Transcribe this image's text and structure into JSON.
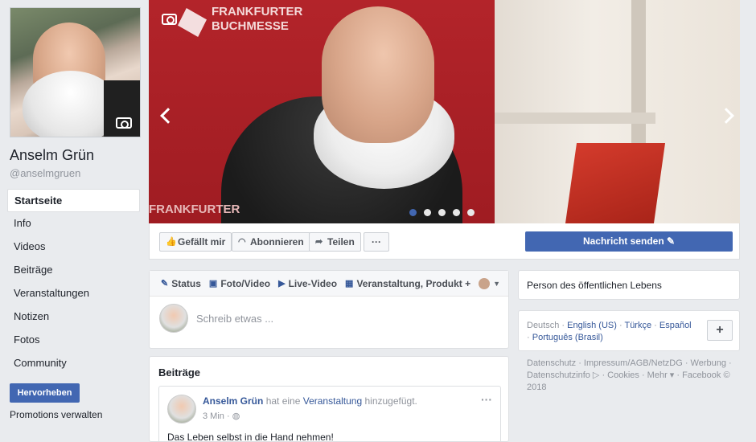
{
  "left": {
    "page_name": "Anselm Grün",
    "handle": "@anselmgruen",
    "nav": [
      "Startseite",
      "Info",
      "Videos",
      "Beiträge",
      "Veranstaltungen",
      "Notizen",
      "Fotos",
      "Community"
    ],
    "promote": "Hervorheben",
    "promotions_manage": "Promotions verwalten"
  },
  "cover": {
    "logo_line1": "FRANKFURTER",
    "logo_line2": "BUCHMESSE",
    "logo_bottom": "FRANKFURTER",
    "slide_count": 5,
    "active_slide": 1
  },
  "actions": {
    "like": "Gefällt mir",
    "subscribe": "Abonnieren",
    "share": "Teilen",
    "more": "···",
    "send_message": "Nachricht senden ✎"
  },
  "composer": {
    "tabs": [
      "Status",
      "Foto/Video",
      "Live-Video",
      "Veranstaltung, Produkt +"
    ],
    "placeholder": "Schreib etwas ..."
  },
  "posts": {
    "title": "Beiträge",
    "author": "Anselm Grün",
    "action_pre": "hat eine",
    "action_link": "Veranstaltung",
    "action_post": "hinzugefügt.",
    "time": "3 Min ·",
    "text": "Das Leben selbst in die Hand nehmen!"
  },
  "right": {
    "category": "Person des öffentlichen Lebens",
    "languages": [
      "Deutsch",
      "English (US)",
      "Türkçe",
      "Español",
      "Português (Brasil)"
    ],
    "footer": "Datenschutz · Impressum/AGB/NetzDG · Werbung · Datenschutzinfo ▷ · Cookies · Mehr ▾ · Facebook © 2018"
  },
  "colors": {
    "brand": "#4267b2",
    "link": "#365899",
    "background": "#e9ebee"
  }
}
